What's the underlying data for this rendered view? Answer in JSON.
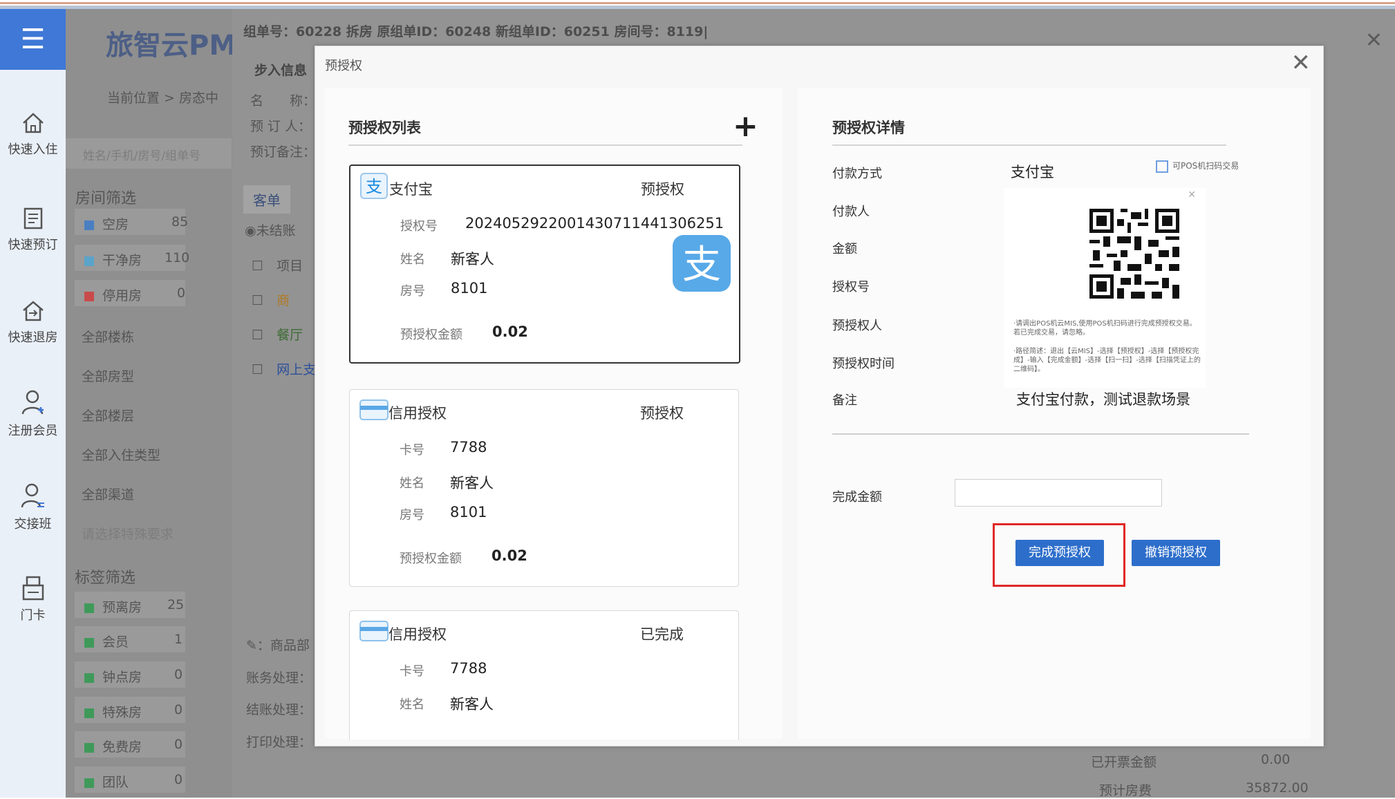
{
  "background": {
    "app_title": "旅智云PM",
    "nav": [
      {
        "label": "快速入住",
        "icon": "home-icon"
      },
      {
        "label": "快速预订",
        "icon": "calendar-icon"
      },
      {
        "label": "快速退房",
        "icon": "checkout-icon"
      },
      {
        "label": "注册会员",
        "icon": "user-add-icon"
      },
      {
        "label": "交接班",
        "icon": "user-switch-icon"
      },
      {
        "label": "门卡",
        "icon": "card-icon"
      }
    ],
    "breadcrumb": "当前位置 > 房态中",
    "search_placeholder": "姓名/手机/房号/组单号",
    "room_filter_title": "房间筛选",
    "room_filters": [
      {
        "label": "空房",
        "count": "85",
        "color": "#4a7fc2"
      },
      {
        "label": "干净房",
        "count": "110",
        "color": "#5aa3c9"
      },
      {
        "label": "停用房",
        "count": "0",
        "color": "#c94a4a"
      }
    ],
    "dropdowns": [
      "全部楼栋",
      "全部房型",
      "全部楼层",
      "全部入住类型",
      "全部渠道"
    ],
    "special_placeholder": "请选择特殊要求",
    "tag_filter_title": "标签筛选",
    "tag_filters": [
      {
        "label": "预离房",
        "count": "25"
      },
      {
        "label": "会员",
        "count": "1"
      },
      {
        "label": "钟点房",
        "count": "0"
      },
      {
        "label": "特殊房",
        "count": "0"
      },
      {
        "label": "免费房",
        "count": "0"
      },
      {
        "label": "团队",
        "count": "0"
      }
    ],
    "order_header": "组单号：60228   拆房 原组单ID：60248 新组单ID：60251 房间号：8119|",
    "guest_info_title": "步入信息",
    "guest_fields": [
      "名　　称：",
      "预 订 人：",
      "预订备注："
    ],
    "tab_label": "客单",
    "radio_label": "未结账",
    "table_rows": [
      "项目",
      "商",
      "餐厅",
      "网上支"
    ],
    "bottom_rows": [
      "商品部",
      "账务处理：",
      "结账处理：",
      "打印处理："
    ],
    "summary": [
      {
        "label": "已开票金额",
        "value": "0.00"
      },
      {
        "label": "预计房费",
        "value": "35872.00"
      }
    ]
  },
  "modal": {
    "title": "预授权",
    "list_title": "预授权列表",
    "detail_title": "预授权详情",
    "cards": [
      {
        "type": "支付宝",
        "status": "预授权",
        "icon": "alipay-icon",
        "fields": [
          {
            "label": "授权号",
            "value": "2024052922001430711441306251"
          },
          {
            "label": "姓名",
            "value": "新客人"
          },
          {
            "label": "房号",
            "value": "8101"
          }
        ],
        "amount_label": "预授权金额",
        "amount": "0.02"
      },
      {
        "type": "信用授权",
        "status": "预授权",
        "icon": "credit-card-icon",
        "fields": [
          {
            "label": "卡号",
            "value": "7788"
          },
          {
            "label": "姓名",
            "value": "新客人"
          },
          {
            "label": "房号",
            "value": "8101"
          }
        ],
        "amount_label": "预授权金额",
        "amount": "0.02"
      },
      {
        "type": "信用授权",
        "status": "已完成",
        "icon": "credit-card-icon",
        "fields": [
          {
            "label": "卡号",
            "value": "7788"
          },
          {
            "label": "姓名",
            "value": "新客人"
          }
        ]
      }
    ],
    "detail": {
      "labels": [
        "付款方式",
        "付款人",
        "金额",
        "授权号",
        "预授权人",
        "预授权时间",
        "备注"
      ],
      "pay_method": "支付宝",
      "pos_hint": "可POS机扫码交易",
      "qr_note_1": "·请调出POS机云MIS,使用POS机扫码进行完成预授权交易。若已完成交易，请忽略。",
      "qr_note_2": "·路径简述：退出【云MIS】-选择【预授权】-选择【预授权完成】-输入【完成金额】-选择【扫一扫】-选择【扫描凭证上的二维码】。",
      "remark": "支付宝付款，测试退款场景",
      "complete_amount_label": "完成金额",
      "complete_amount_value": "",
      "complete_button": "完成预授权",
      "cancel_button": "撤销预授权"
    }
  }
}
